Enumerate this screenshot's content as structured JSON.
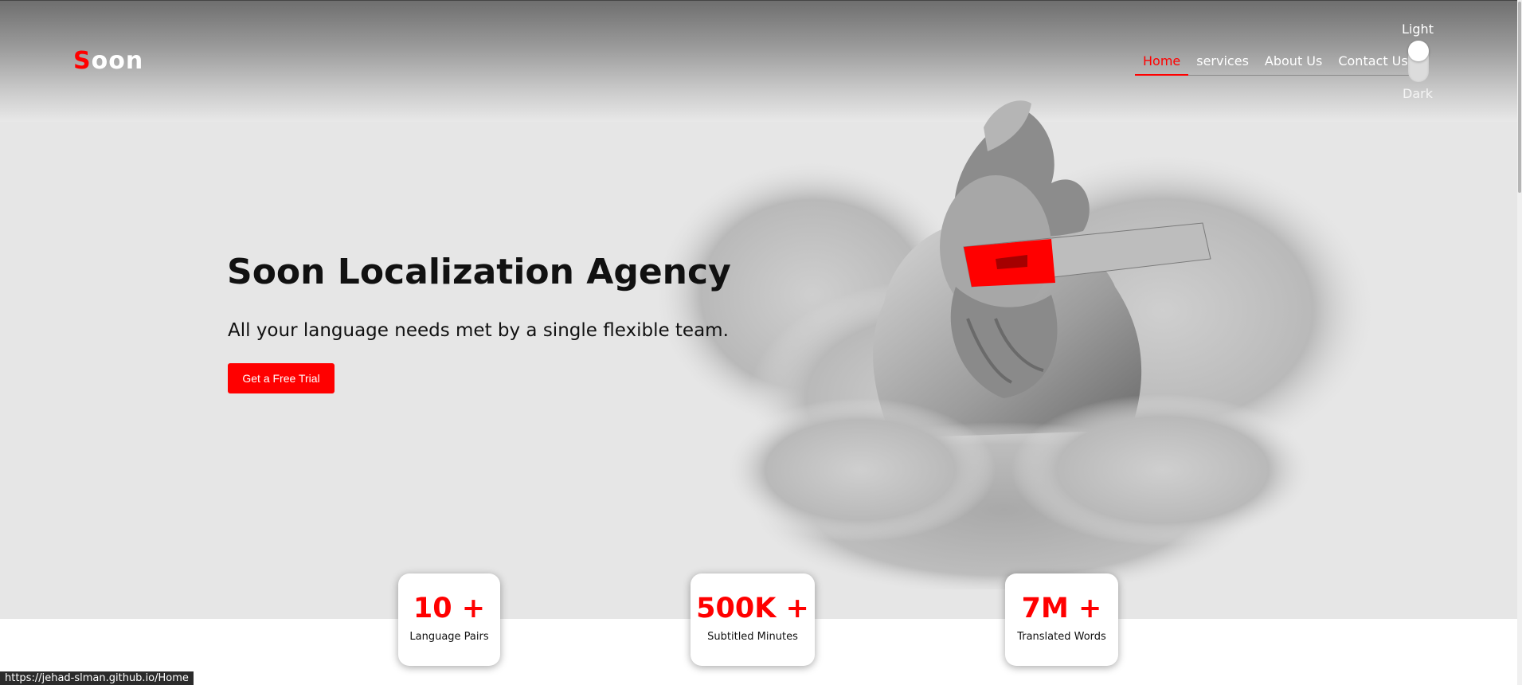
{
  "header": {
    "logo": {
      "first_letter": "S",
      "rest": "oon"
    },
    "nav": [
      {
        "label": "Home",
        "active": true
      },
      {
        "label": "services",
        "active": false
      },
      {
        "label": "About Us",
        "active": false
      },
      {
        "label": "Contact Us",
        "active": false
      }
    ],
    "theme_toggle": {
      "light_label": "Light",
      "dark_label": "Dark",
      "state": "light"
    }
  },
  "hero": {
    "title": "Soon Localization Agency",
    "subtitle": "All your language needs met by a single flexible team.",
    "cta_label": "Get a Free Trial",
    "image_icon": "statue-in-clouds-illustration"
  },
  "stats": [
    {
      "value": "10 +",
      "caption": "Language Pairs"
    },
    {
      "value": "500K +",
      "caption": "Subtitled Minutes"
    },
    {
      "value": "7M +",
      "caption": "Translated Words"
    }
  ],
  "status_bar": {
    "url": "https://jehad-slman.github.io/Home"
  },
  "colors": {
    "accent": "#ff0000",
    "background": "#e6e6e6",
    "text": "#111111"
  }
}
